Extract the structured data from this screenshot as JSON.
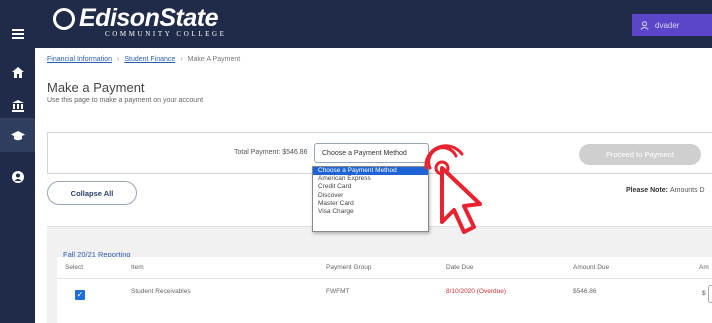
{
  "brand": {
    "name": "EdisonState",
    "subtitle": "COMMUNITY COLLEGE",
    "bar_color": "#1f2b48",
    "accent_color": "#5b45c9"
  },
  "user": {
    "name": "dvader",
    "icon": "user-icon"
  },
  "nav": {
    "icons": [
      "menu-icon",
      "home-icon",
      "bank-icon",
      "graduation-cap-icon",
      "user-circle-icon"
    ]
  },
  "breadcrumb": {
    "items": [
      "Financial Information",
      "Student Finance",
      "Make A Payment"
    ]
  },
  "page": {
    "title": "Make a Payment",
    "subtitle": "Use this page to make a payment on your account"
  },
  "payment": {
    "total_label": "Total Payment: $546.86",
    "method_value": "Choose a Payment Method",
    "method_options": [
      "Choose a Payment Method",
      "American Express",
      "Credit Card",
      "Discover",
      "Master Card",
      "Visa Charge"
    ],
    "selected_index": 0,
    "proceed_label": "Proceed to Payment"
  },
  "collapse_label": "Collapse All",
  "note": {
    "label": "Please Note:",
    "text": "Amounts D"
  },
  "section": {
    "title": "Fall 20/21 Reporting",
    "columns": [
      "Select",
      "Item",
      "Payment Group",
      "Date Due",
      "Amount Due",
      "Am"
    ],
    "rows": [
      {
        "selected": true,
        "item": "Student Receivables",
        "group": "FWFMT",
        "date_due": "8/10/2020 (Overdue)",
        "amount_due": "$546.86",
        "amount_prefix": "$"
      }
    ]
  },
  "annotation_color": "#e8232f"
}
